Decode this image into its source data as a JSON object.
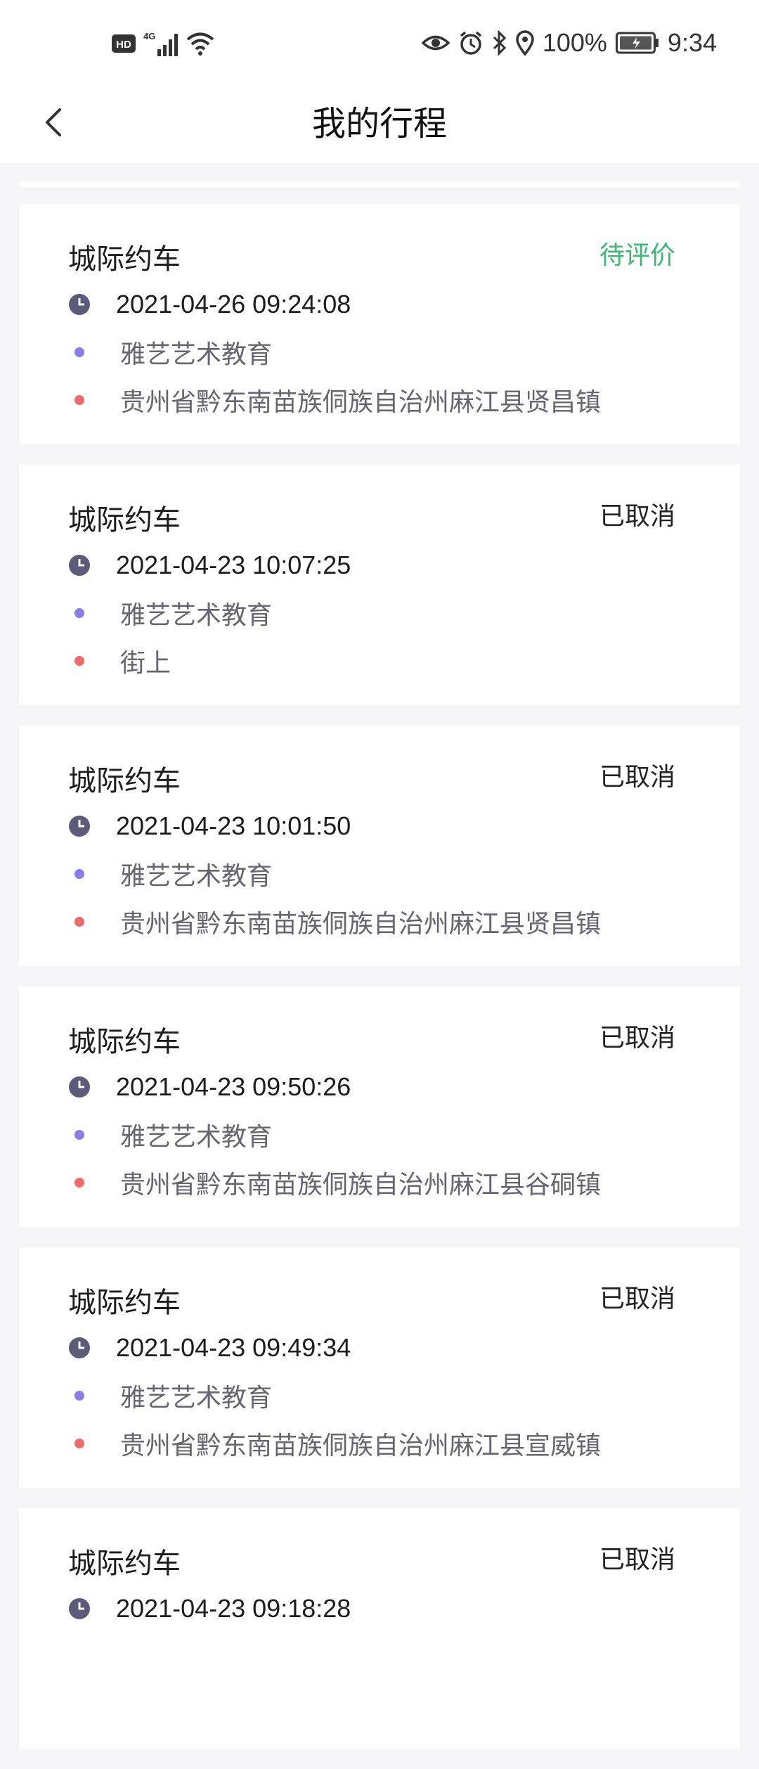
{
  "statusbar": {
    "left_icons": [
      "hd-icon",
      "4g-signal-icon",
      "wifi-icon"
    ],
    "right_icons": [
      "eye-icon",
      "alarm-icon",
      "bluetooth-icon",
      "location-icon"
    ],
    "battery_text": "100%",
    "time": "9:34"
  },
  "navbar": {
    "title": "我的行程",
    "back_icon": "chevron-left-icon"
  },
  "colors": {
    "pending_status": "#3cb971",
    "from_dot": "#8a7de8",
    "to_dot": "#ef6b6b",
    "clock_icon": "#5d5b7a"
  },
  "trips": [
    {
      "title": "城际约车",
      "status": "待评价",
      "time": "2021-04-26 09:24:08",
      "from": "雅艺艺术教育",
      "to": "贵州省黔东南苗族侗族自治州麻江县贤昌镇"
    },
    {
      "title": "城际约车",
      "status": "已取消",
      "time": "2021-04-23 10:07:25",
      "from": "雅艺艺术教育",
      "to": "街上"
    },
    {
      "title": "城际约车",
      "status": "已取消",
      "time": "2021-04-23 10:01:50",
      "from": "雅艺艺术教育",
      "to": "贵州省黔东南苗族侗族自治州麻江县贤昌镇"
    },
    {
      "title": "城际约车",
      "status": "已取消",
      "time": "2021-04-23 09:50:26",
      "from": "雅艺艺术教育",
      "to": "贵州省黔东南苗族侗族自治州麻江县谷硐镇"
    },
    {
      "title": "城际约车",
      "status": "已取消",
      "time": "2021-04-23 09:49:34",
      "from": "雅艺艺术教育",
      "to": "贵州省黔东南苗族侗族自治州麻江县宣威镇"
    },
    {
      "title": "城际约车",
      "status": "已取消",
      "time": "2021-04-23 09:18:28",
      "from": "",
      "to": ""
    }
  ]
}
